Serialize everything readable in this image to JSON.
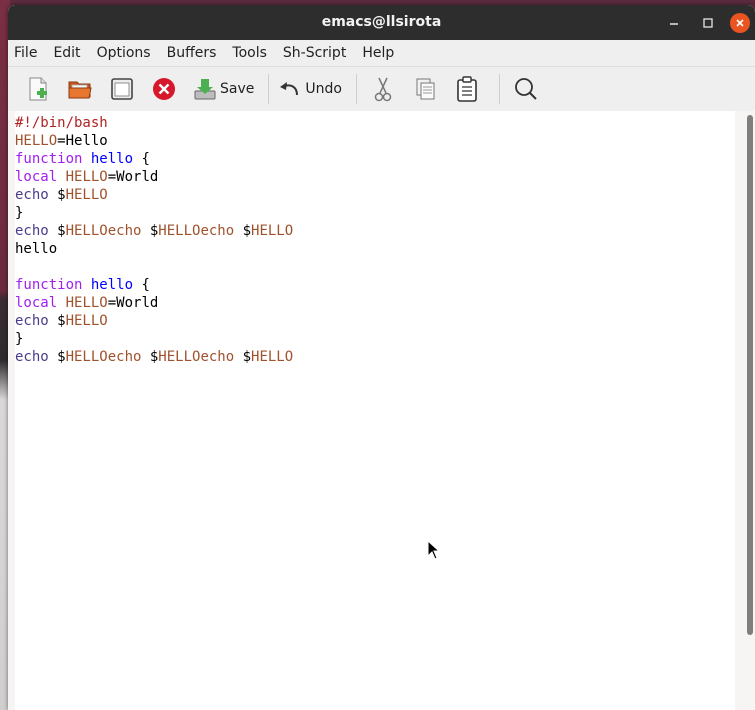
{
  "window": {
    "title": "emacs@llsirota"
  },
  "menubar": {
    "items": [
      "File",
      "Edit",
      "Options",
      "Buffers",
      "Tools",
      "Sh-Script",
      "Help"
    ]
  },
  "toolbar": {
    "save_label": "Save",
    "undo_label": "Undo"
  },
  "editor": {
    "lines": [
      [
        {
          "t": "#!/bin/bash",
          "c": "comment"
        }
      ],
      [
        {
          "t": "HELLO",
          "c": "var"
        },
        {
          "t": "=Hello",
          "c": "plain"
        }
      ],
      [
        {
          "t": "function",
          "c": "kw"
        },
        {
          "t": " ",
          "c": "plain"
        },
        {
          "t": "hello",
          "c": "fn"
        },
        {
          "t": " {",
          "c": "plain"
        }
      ],
      [
        {
          "t": "local",
          "c": "kw"
        },
        {
          "t": " ",
          "c": "plain"
        },
        {
          "t": "HELLO",
          "c": "var"
        },
        {
          "t": "=World",
          "c": "plain"
        }
      ],
      [
        {
          "t": "echo",
          "c": "bi"
        },
        {
          "t": " $",
          "c": "plain"
        },
        {
          "t": "HELLO",
          "c": "var"
        }
      ],
      [
        {
          "t": "}",
          "c": "plain"
        }
      ],
      [
        {
          "t": "echo",
          "c": "bi"
        },
        {
          "t": " $",
          "c": "plain"
        },
        {
          "t": "HELLOecho",
          "c": "var"
        },
        {
          "t": " $",
          "c": "plain"
        },
        {
          "t": "HELLOecho",
          "c": "var"
        },
        {
          "t": " $",
          "c": "plain"
        },
        {
          "t": "HELLO",
          "c": "var"
        }
      ],
      [
        {
          "t": "hello",
          "c": "plain"
        }
      ],
      [],
      [
        {
          "t": "function",
          "c": "kw"
        },
        {
          "t": " ",
          "c": "plain"
        },
        {
          "t": "hello",
          "c": "fn"
        },
        {
          "t": " {",
          "c": "plain"
        }
      ],
      [
        {
          "t": "local",
          "c": "kw"
        },
        {
          "t": " ",
          "c": "plain"
        },
        {
          "t": "HELLO",
          "c": "var"
        },
        {
          "t": "=World",
          "c": "plain"
        }
      ],
      [
        {
          "t": "echo",
          "c": "bi"
        },
        {
          "t": " $",
          "c": "plain"
        },
        {
          "t": "HELLO",
          "c": "var"
        }
      ],
      [
        {
          "t": "}",
          "c": "plain"
        }
      ],
      [
        {
          "t": "echo",
          "c": "bi"
        },
        {
          "t": " $",
          "c": "plain"
        },
        {
          "t": "HELLOecho",
          "c": "var"
        },
        {
          "t": " $",
          "c": "plain"
        },
        {
          "t": "HELLOecho",
          "c": "var"
        },
        {
          "t": " $",
          "c": "plain"
        },
        {
          "t": "HELLO",
          "c": "var"
        }
      ]
    ]
  },
  "colors": {
    "titlebar": "#2d2d2d",
    "close_button": "#e95420",
    "comment": "#b22222",
    "keyword": "#a020f0",
    "function_name": "#0000ff",
    "variable": "#a0522d",
    "builtin": "#483d8b"
  },
  "icons": [
    "new-file-icon",
    "open-folder-icon",
    "window-icon",
    "close-buffer-icon",
    "save-icon",
    "undo-icon",
    "cut-icon",
    "copy-icon",
    "paste-icon",
    "search-icon"
  ]
}
